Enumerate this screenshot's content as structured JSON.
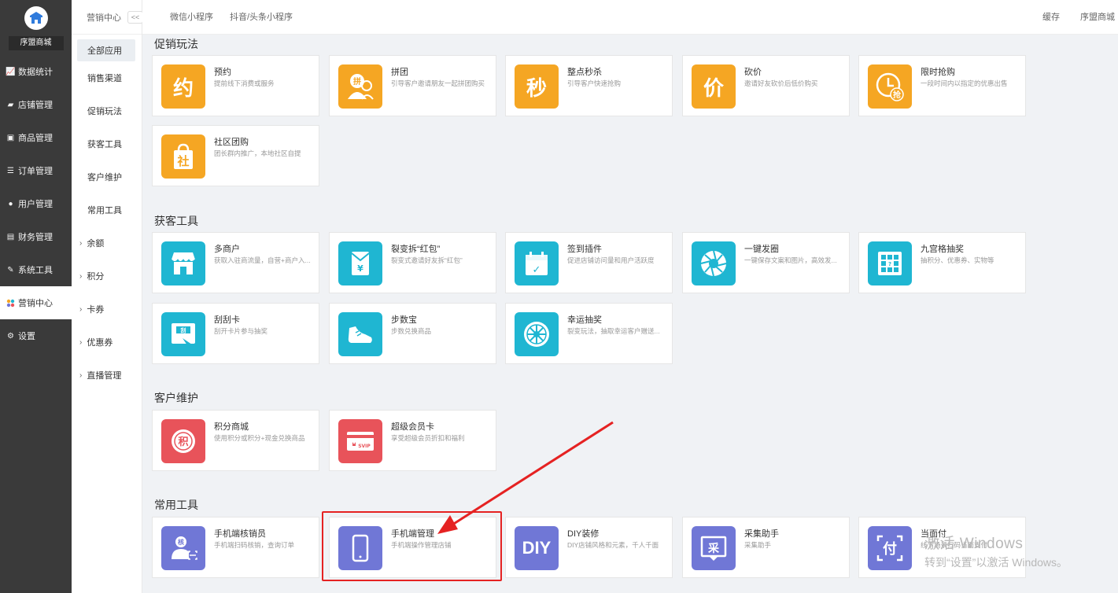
{
  "sidebar": {
    "shop_name": "序盟商城",
    "items": [
      {
        "label": "数据统计",
        "icon": "chart-icon"
      },
      {
        "label": "店铺管理",
        "icon": "store-icon"
      },
      {
        "label": "商品管理",
        "icon": "goods-icon"
      },
      {
        "label": "订单管理",
        "icon": "order-icon"
      },
      {
        "label": "用户管理",
        "icon": "user-icon"
      },
      {
        "label": "财务管理",
        "icon": "finance-icon"
      },
      {
        "label": "系统工具",
        "icon": "wrench-icon"
      },
      {
        "label": "营销中心",
        "icon": "marketing-icon"
      },
      {
        "label": "设置",
        "icon": "gear-icon"
      }
    ]
  },
  "subnav": {
    "header": "营销中心",
    "collapse_label": "<<",
    "items": [
      "全部应用",
      "销售渠道",
      "促销玩法",
      "获客工具",
      "客户维护",
      "常用工具"
    ],
    "expand_items": [
      "余额",
      "积分",
      "卡券",
      "优惠券",
      "直播管理"
    ]
  },
  "topbar": {
    "tabs": [
      "微信小程序",
      "抖音/头条小程序"
    ],
    "cache": "缓存",
    "shop": "序盟商城"
  },
  "sections": {
    "promo": "促销玩法",
    "acquire": "获客工具",
    "retain": "客户维护",
    "common": "常用工具"
  },
  "cards": {
    "promo": [
      {
        "name": "预约",
        "desc": "提前线下消费或服务",
        "glyph": "约"
      },
      {
        "name": "拼团",
        "desc": "引导客户邀请朋友一起拼团购买",
        "glyph": "拼"
      },
      {
        "name": "整点秒杀",
        "desc": "引导客户快速抢购",
        "glyph": "秒"
      },
      {
        "name": "砍价",
        "desc": "邀请好友砍价后低价购买",
        "glyph": "价"
      },
      {
        "name": "限时抢购",
        "desc": "一段时间内以指定的优惠出售",
        "glyph": "抢"
      },
      {
        "name": "社区团购",
        "desc": "团长群内推广，本地社区自提",
        "glyph": "社"
      }
    ],
    "acquire": [
      {
        "name": "多商户",
        "desc": "获取入驻商流量，自营+商户入...",
        "icon": "store-front-icon"
      },
      {
        "name": "裂变拆“红包”",
        "desc": "裂变式邀请好友拆“红包”",
        "glyph": "¥"
      },
      {
        "name": "签到插件",
        "desc": "促进店铺访问量和用户活跃度",
        "glyph": "✓"
      },
      {
        "name": "一键发圈",
        "desc": "一键保存文案和图片，高效发...",
        "icon": "aperture-icon"
      },
      {
        "name": "九宫格抽奖",
        "desc": "抽积分、优惠券、实物等",
        "icon": "grid-icon"
      },
      {
        "name": "刮刮卡",
        "desc": "刮开卡片参与抽奖",
        "glyph": "刮"
      },
      {
        "name": "步数宝",
        "desc": "步数兑换商品",
        "icon": "shoe-icon"
      },
      {
        "name": "幸运抽奖",
        "desc": "裂变玩法，抽取幸运客户赠送...",
        "icon": "wheel-icon"
      }
    ],
    "retain": [
      {
        "name": "积分商城",
        "desc": "使用积分或积分+现金兑换商品",
        "glyph": "积"
      },
      {
        "name": "超级会员卡",
        "desc": "享受超级会员折扣和福利",
        "glyph": "SVIP"
      }
    ],
    "common": [
      {
        "name": "手机端核销员",
        "desc": "手机端扫码核销，查询订单",
        "glyph": "核"
      },
      {
        "name": "手机端管理",
        "desc": "手机端操作管理店铺",
        "icon": "phone-icon"
      },
      {
        "name": "DIY装修",
        "desc": "DIY店铺风格和元素，千人千面",
        "glyph": "DIY"
      },
      {
        "name": "采集助手",
        "desc": "采集助手",
        "glyph": "采"
      },
      {
        "name": "当面付",
        "desc": "线下场景扫码当面支付",
        "glyph": "付"
      }
    ]
  },
  "watermark": {
    "line1": "激活 Windows",
    "line2": "转到“设置”以激活 Windows。"
  },
  "colors": {
    "orange": "#f5a623",
    "teal": "#1fb6d2",
    "red": "#e8535a",
    "purple": "#7077d6",
    "highlight": "#e52222"
  }
}
